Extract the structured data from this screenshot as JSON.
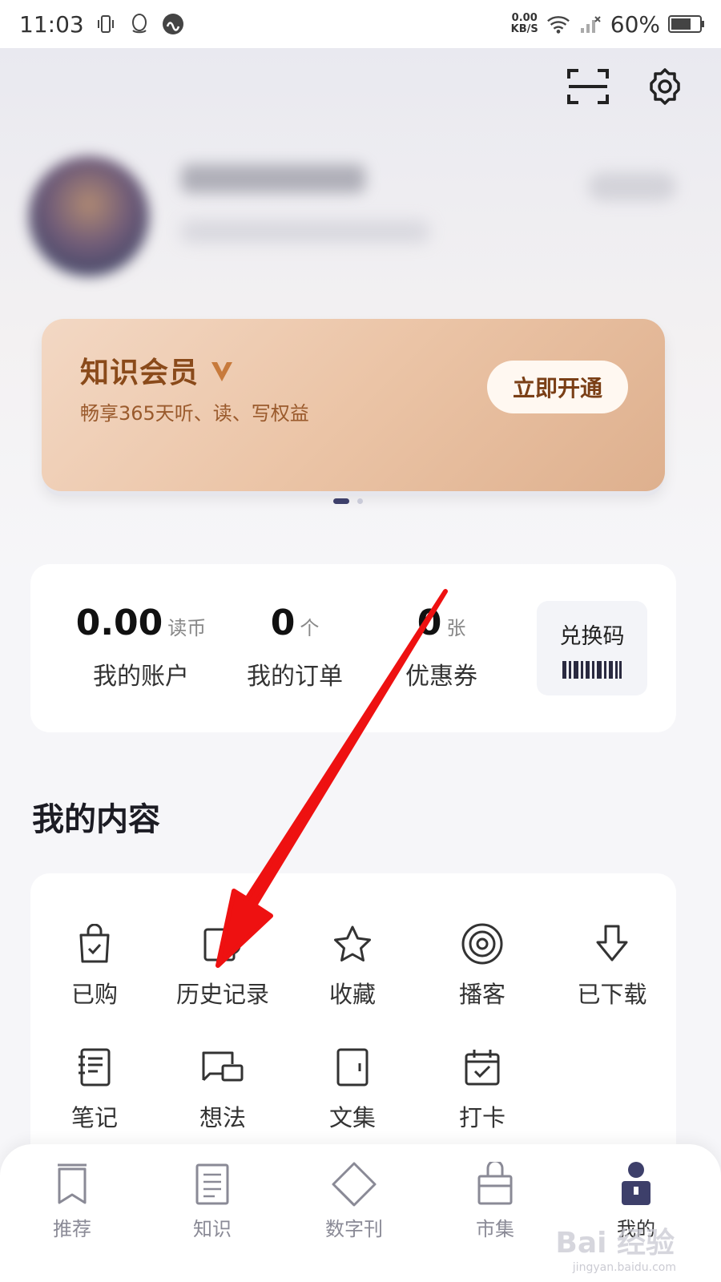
{
  "status_bar": {
    "time": "11:03",
    "net_speed_value": "0.00",
    "net_speed_unit": "KB/S",
    "battery": "60%"
  },
  "member": {
    "title": "知识会员",
    "subtitle": "畅享365天听、读、写权益",
    "button": "立即开通"
  },
  "account": {
    "balance_value": "0.00",
    "balance_unit": "读币",
    "balance_label": "我的账户",
    "orders_value": "0",
    "orders_unit": "个",
    "orders_label": "我的订单",
    "coupons_value": "0",
    "coupons_unit": "张",
    "coupons_label": "优惠券",
    "redeem_label": "兑换码"
  },
  "content": {
    "title": "我的内容",
    "items": [
      {
        "label": "已购",
        "icon": "bag-icon"
      },
      {
        "label": "历史记录",
        "icon": "history-icon"
      },
      {
        "label": "收藏",
        "icon": "star-icon"
      },
      {
        "label": "播客",
        "icon": "podcast-icon"
      },
      {
        "label": "已下载",
        "icon": "download-icon"
      },
      {
        "label": "笔记",
        "icon": "note-icon"
      },
      {
        "label": "想法",
        "icon": "thought-icon"
      },
      {
        "label": "文集",
        "icon": "collection-icon"
      },
      {
        "label": "打卡",
        "icon": "checkin-icon"
      }
    ]
  },
  "nav": {
    "items": [
      {
        "label": "推荐",
        "icon": "bookmark-icon"
      },
      {
        "label": "知识",
        "icon": "document-icon"
      },
      {
        "label": "数字刊",
        "icon": "diamond-icon"
      },
      {
        "label": "市集",
        "icon": "shopping-bag-icon"
      },
      {
        "label": "我的",
        "icon": "profile-icon"
      }
    ],
    "active_index": 4
  },
  "watermark": {
    "text": "Bai 经验",
    "sub": "jingyan.baidu.com"
  },
  "colors": {
    "accent": "#3d3f6a",
    "member_text": "#8a4a1a",
    "annotation_arrow": "#ee1111"
  }
}
